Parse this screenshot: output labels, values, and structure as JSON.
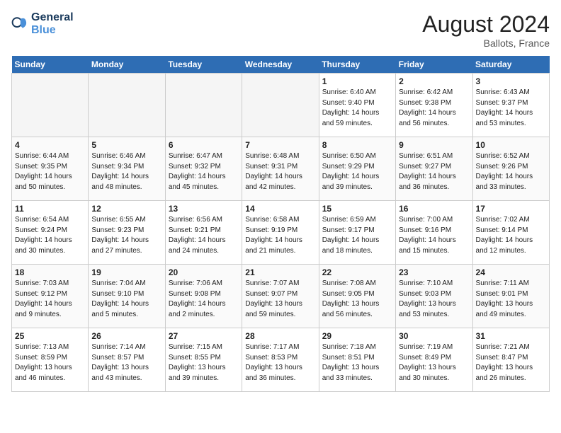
{
  "header": {
    "logo_text_general": "General",
    "logo_text_blue": "Blue",
    "month_year": "August 2024",
    "location": "Ballots, France"
  },
  "days_of_week": [
    "Sunday",
    "Monday",
    "Tuesday",
    "Wednesday",
    "Thursday",
    "Friday",
    "Saturday"
  ],
  "weeks": [
    [
      {
        "day": "",
        "empty": true
      },
      {
        "day": "",
        "empty": true
      },
      {
        "day": "",
        "empty": true
      },
      {
        "day": "",
        "empty": true
      },
      {
        "day": "1",
        "sunrise": "6:40 AM",
        "sunset": "9:40 PM",
        "daylight": "14 hours and 59 minutes."
      },
      {
        "day": "2",
        "sunrise": "6:42 AM",
        "sunset": "9:38 PM",
        "daylight": "14 hours and 56 minutes."
      },
      {
        "day": "3",
        "sunrise": "6:43 AM",
        "sunset": "9:37 PM",
        "daylight": "14 hours and 53 minutes."
      }
    ],
    [
      {
        "day": "4",
        "sunrise": "6:44 AM",
        "sunset": "9:35 PM",
        "daylight": "14 hours and 50 minutes."
      },
      {
        "day": "5",
        "sunrise": "6:46 AM",
        "sunset": "9:34 PM",
        "daylight": "14 hours and 48 minutes."
      },
      {
        "day": "6",
        "sunrise": "6:47 AM",
        "sunset": "9:32 PM",
        "daylight": "14 hours and 45 minutes."
      },
      {
        "day": "7",
        "sunrise": "6:48 AM",
        "sunset": "9:31 PM",
        "daylight": "14 hours and 42 minutes."
      },
      {
        "day": "8",
        "sunrise": "6:50 AM",
        "sunset": "9:29 PM",
        "daylight": "14 hours and 39 minutes."
      },
      {
        "day": "9",
        "sunrise": "6:51 AM",
        "sunset": "9:27 PM",
        "daylight": "14 hours and 36 minutes."
      },
      {
        "day": "10",
        "sunrise": "6:52 AM",
        "sunset": "9:26 PM",
        "daylight": "14 hours and 33 minutes."
      }
    ],
    [
      {
        "day": "11",
        "sunrise": "6:54 AM",
        "sunset": "9:24 PM",
        "daylight": "14 hours and 30 minutes."
      },
      {
        "day": "12",
        "sunrise": "6:55 AM",
        "sunset": "9:23 PM",
        "daylight": "14 hours and 27 minutes."
      },
      {
        "day": "13",
        "sunrise": "6:56 AM",
        "sunset": "9:21 PM",
        "daylight": "14 hours and 24 minutes."
      },
      {
        "day": "14",
        "sunrise": "6:58 AM",
        "sunset": "9:19 PM",
        "daylight": "14 hours and 21 minutes."
      },
      {
        "day": "15",
        "sunrise": "6:59 AM",
        "sunset": "9:17 PM",
        "daylight": "14 hours and 18 minutes."
      },
      {
        "day": "16",
        "sunrise": "7:00 AM",
        "sunset": "9:16 PM",
        "daylight": "14 hours and 15 minutes."
      },
      {
        "day": "17",
        "sunrise": "7:02 AM",
        "sunset": "9:14 PM",
        "daylight": "14 hours and 12 minutes."
      }
    ],
    [
      {
        "day": "18",
        "sunrise": "7:03 AM",
        "sunset": "9:12 PM",
        "daylight": "14 hours and 9 minutes."
      },
      {
        "day": "19",
        "sunrise": "7:04 AM",
        "sunset": "9:10 PM",
        "daylight": "14 hours and 5 minutes."
      },
      {
        "day": "20",
        "sunrise": "7:06 AM",
        "sunset": "9:08 PM",
        "daylight": "14 hours and 2 minutes."
      },
      {
        "day": "21",
        "sunrise": "7:07 AM",
        "sunset": "9:07 PM",
        "daylight": "13 hours and 59 minutes."
      },
      {
        "day": "22",
        "sunrise": "7:08 AM",
        "sunset": "9:05 PM",
        "daylight": "13 hours and 56 minutes."
      },
      {
        "day": "23",
        "sunrise": "7:10 AM",
        "sunset": "9:03 PM",
        "daylight": "13 hours and 53 minutes."
      },
      {
        "day": "24",
        "sunrise": "7:11 AM",
        "sunset": "9:01 PM",
        "daylight": "13 hours and 49 minutes."
      }
    ],
    [
      {
        "day": "25",
        "sunrise": "7:13 AM",
        "sunset": "8:59 PM",
        "daylight": "13 hours and 46 minutes."
      },
      {
        "day": "26",
        "sunrise": "7:14 AM",
        "sunset": "8:57 PM",
        "daylight": "13 hours and 43 minutes."
      },
      {
        "day": "27",
        "sunrise": "7:15 AM",
        "sunset": "8:55 PM",
        "daylight": "13 hours and 39 minutes."
      },
      {
        "day": "28",
        "sunrise": "7:17 AM",
        "sunset": "8:53 PM",
        "daylight": "13 hours and 36 minutes."
      },
      {
        "day": "29",
        "sunrise": "7:18 AM",
        "sunset": "8:51 PM",
        "daylight": "13 hours and 33 minutes."
      },
      {
        "day": "30",
        "sunrise": "7:19 AM",
        "sunset": "8:49 PM",
        "daylight": "13 hours and 30 minutes."
      },
      {
        "day": "31",
        "sunrise": "7:21 AM",
        "sunset": "8:47 PM",
        "daylight": "13 hours and 26 minutes."
      }
    ]
  ]
}
